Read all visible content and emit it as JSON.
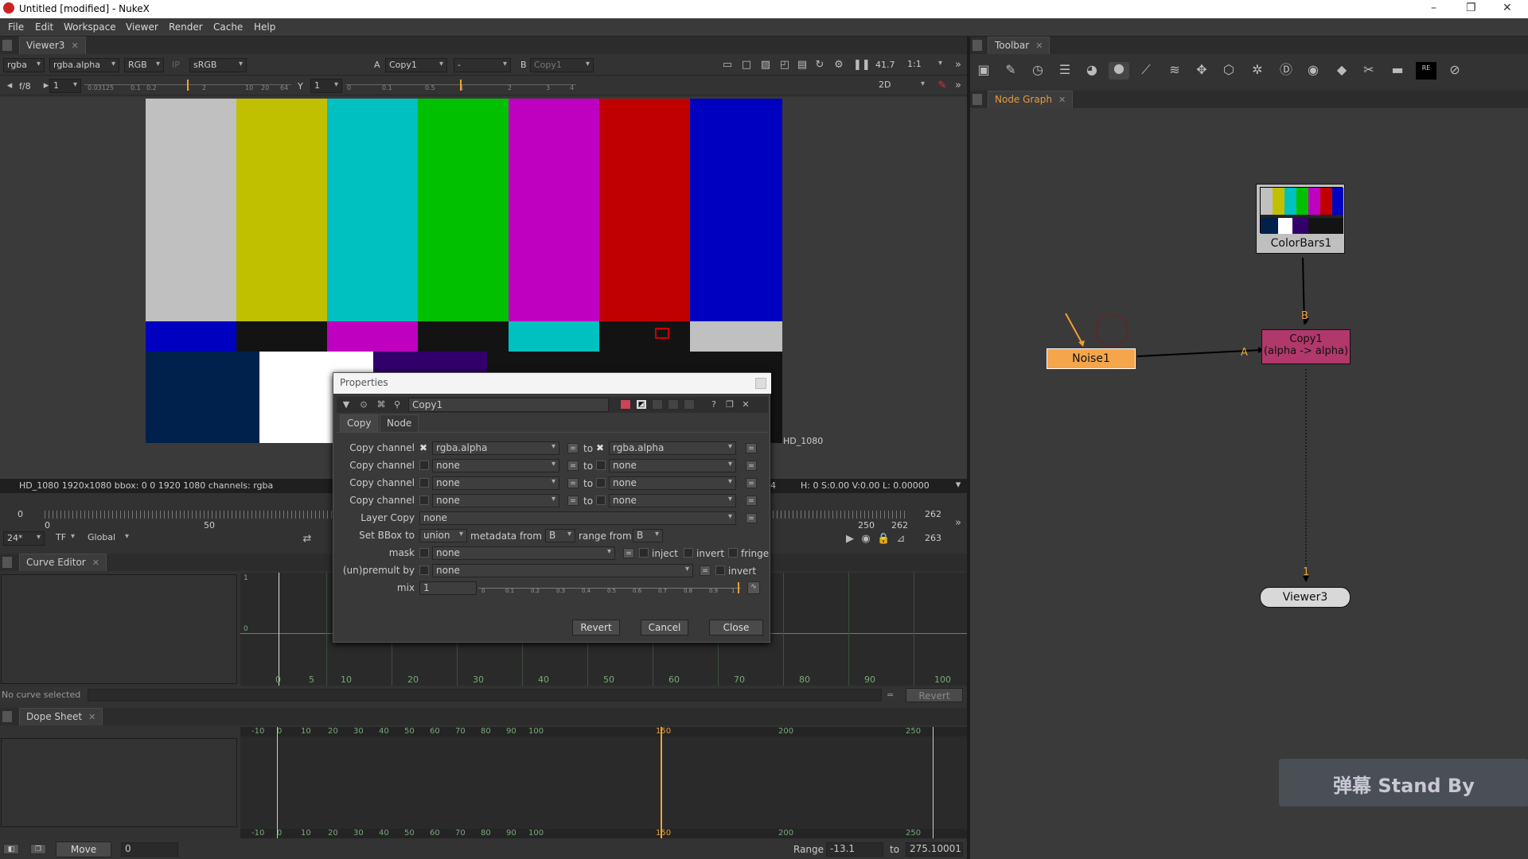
{
  "window": {
    "title": "Untitled [modified] - NukeX",
    "minimize": "–",
    "maximize": "❐",
    "close": "✕"
  },
  "menu": [
    "File",
    "Edit",
    "Workspace",
    "Viewer",
    "Render",
    "Cache",
    "Help"
  ],
  "viewer_tab": {
    "label": "Viewer3",
    "close": "✕"
  },
  "viewer_controls": {
    "channels": "rgba",
    "alpha": "rgba.alpha",
    "display": "RGB",
    "ip": "IP",
    "lut": "sRGB",
    "a_label": "A",
    "a_input": "Copy1",
    "wipe": "-",
    "b_label": "B",
    "b_input": "Copy1",
    "zoom": "41.7",
    "ratio": "1:1",
    "fstop": "f/8",
    "gain": "1",
    "y_label": "Y",
    "gamma": "1",
    "mode": "2D"
  },
  "viewer_format_label": "HD_1080",
  "viewer_info": "HD_1080 1920x1080  bbox: 0 0 1920 1080 channels: rgba",
  "viewer_info_right": "H:  0 S:0.00 V:0.00  L: 0.00000",
  "viewer_info_frame": "4",
  "timeline": {
    "start": "0",
    "tick0": "0",
    "tick50": "50",
    "tick250": "250",
    "tick262": "262",
    "end": "262",
    "frame": "263",
    "fps": "24*",
    "tf": "TF",
    "scope": "Global"
  },
  "gain_ticks": [
    "0.03125",
    "0.1",
    "0.2",
    "1",
    "2",
    "10",
    "20",
    "64"
  ],
  "gamma_ticks": [
    "0",
    "0.1",
    "0.5",
    "1",
    "2",
    "3",
    "4"
  ],
  "curve_editor": {
    "tab": "Curve Editor",
    "status": "No curve selected",
    "revert": "Revert",
    "eq": "=",
    "y1": "1",
    "y0": "0",
    "ticks": [
      "0",
      "5",
      "10",
      "20",
      "30",
      "40",
      "50",
      "60",
      "70",
      "80",
      "90",
      "100"
    ]
  },
  "dope_sheet": {
    "tab": "Dope Sheet",
    "ticks": [
      "-10",
      "0",
      "10",
      "20",
      "30",
      "40",
      "50",
      "60",
      "70",
      "80",
      "90",
      "100",
      "150",
      "200",
      "250"
    ],
    "move": "Move",
    "move_value": "0",
    "range_label": "Range",
    "range_from": "-13.1",
    "to_label": "to",
    "range_to": "275.10001"
  },
  "toolbar_tab": {
    "label": "Toolbar",
    "close": "✕"
  },
  "node_graph_tab": {
    "label": "Node Graph",
    "close": "✕"
  },
  "nodes": {
    "colorbars": "ColorBars1",
    "noise": "Noise1",
    "copy_title": "Copy1",
    "copy_sub": "(alpha -> alpha)",
    "viewer": "Viewer3",
    "edge_b": "B",
    "edge_a": "A",
    "edge_1": "1"
  },
  "watermark": "弹幕 Stand By",
  "properties": {
    "title": "Properties",
    "node_name": "Copy1",
    "tabs": [
      "Copy",
      "Node"
    ],
    "copy_label": "Copy channel",
    "rows": [
      {
        "from": "rgba.alpha",
        "to": "rgba.alpha",
        "checked": true
      },
      {
        "from": "none",
        "to": "none",
        "checked": false
      },
      {
        "from": "none",
        "to": "none",
        "checked": false
      },
      {
        "from": "none",
        "to": "none",
        "checked": false
      }
    ],
    "to_word": "to",
    "eq": "=",
    "layer_copy_label": "Layer Copy",
    "layer_copy_value": "none",
    "bbox_label": "Set BBox to",
    "bbox_value": "union",
    "metadata_label": "metadata from",
    "metadata_value": "B",
    "range_label": "range from",
    "range_value": "B",
    "mask_label": "mask",
    "mask_value": "none",
    "inject": "inject",
    "invert": "invert",
    "fringe": "fringe",
    "premult_label": "(un)premult by",
    "premult_value": "none",
    "mix_label": "mix",
    "mix_value": "1",
    "mix_ticks": [
      "0",
      "0.1",
      "0.2",
      "0.3",
      "0.4",
      "0.5",
      "0.6",
      "0.7",
      "0.8",
      "0.9",
      "1"
    ],
    "buttons": {
      "revert": "Revert",
      "cancel": "Cancel",
      "close": "Close"
    },
    "help": "?"
  },
  "colors": {
    "noise_node": "#f5a54a",
    "copy_node": "#b0386a",
    "orange_arrow": "#f0a030",
    "nodegraph_tab": "#e89a3c"
  }
}
